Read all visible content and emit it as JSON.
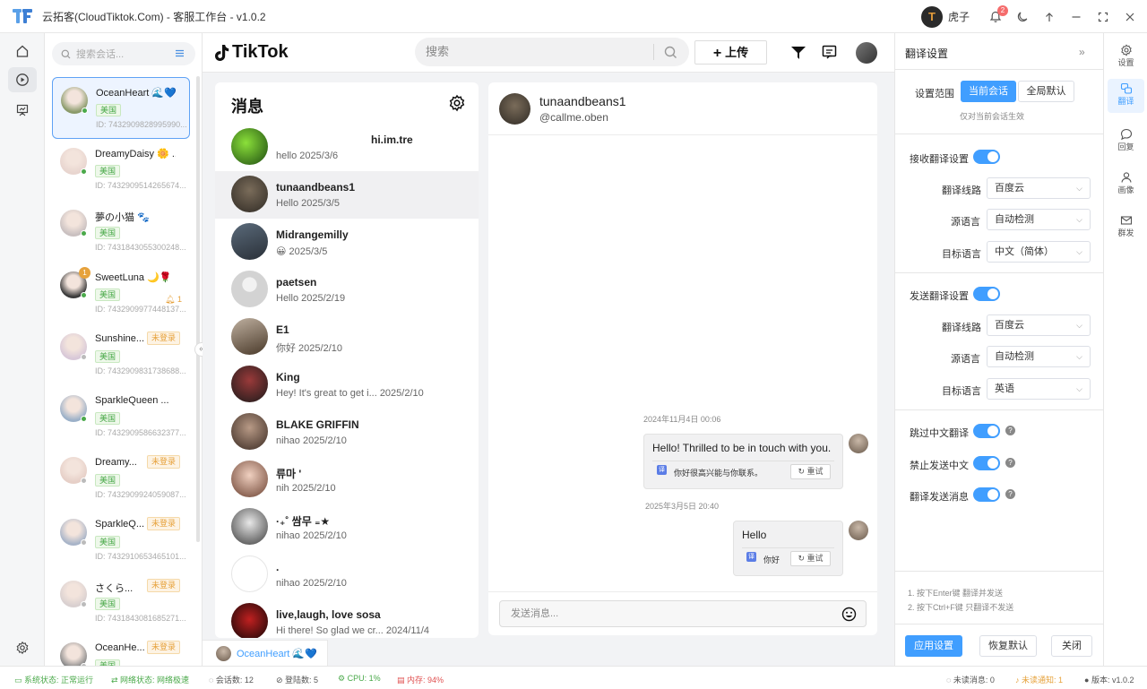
{
  "window": {
    "title": "云拓客(CloudTiktok.Com) - 客服工作台 - v1.0.2",
    "user_name": "虎子",
    "notif_count": "2"
  },
  "accounts": {
    "search_placeholder": "搜索会话...",
    "items": [
      {
        "name": "OceanHeart 🌊💙",
        "region": "美国",
        "id": "ID: 7432909828995990..."
      },
      {
        "name": "DreamyDaisy 🌼 ...",
        "region": "美国",
        "id": "ID: 7432909514265674..."
      },
      {
        "name": "夢の小猫 🐾",
        "region": "美国",
        "id": "ID: 7431843055300248..."
      },
      {
        "name": "SweetLuna 🌙🌹",
        "region": "美国",
        "id": "ID: 7432909977448137...",
        "badge": "1",
        "notif": "1"
      },
      {
        "name": "Sunshine...",
        "region": "美国",
        "id": "ID: 7432909831738688...",
        "status": "未登录"
      },
      {
        "name": "SparkleQueen ...",
        "region": "美国",
        "id": "ID: 7432909586632377..."
      },
      {
        "name": "Dreamy...",
        "region": "美国",
        "id": "ID: 7432909924059087...",
        "status": "未登录"
      },
      {
        "name": "SparkleQ...",
        "region": "美国",
        "id": "ID: 7432910653465101...",
        "status": "未登录"
      },
      {
        "name": "さくら...",
        "region": "美国",
        "id": "ID: 7431843081685271...",
        "status": "未登录"
      },
      {
        "name": "OceanHe...",
        "region": "美国",
        "id": "",
        "status": "未登录"
      }
    ]
  },
  "tiktok": {
    "brand": "TikTok",
    "search_placeholder": "搜索",
    "upload_label": "上传"
  },
  "messages": {
    "title": "消息",
    "conversations": [
      {
        "name": "hi.im.tre",
        "preview": "hello 2025/3/6"
      },
      {
        "name": "tunaandbeans1",
        "preview": "Hello 2025/3/5"
      },
      {
        "name": "Midrangemilly",
        "preview": "😀 2025/3/5"
      },
      {
        "name": "paetsen",
        "preview": "Hello 2025/2/19"
      },
      {
        "name": "E1",
        "preview": "你好 2025/2/10"
      },
      {
        "name": "King",
        "preview": "Hey! It's great to get i...   2025/2/10"
      },
      {
        "name": "BLAKE GRIFFIN",
        "preview": "nihao 2025/2/10"
      },
      {
        "name": "류마 '",
        "preview": "nih 2025/2/10"
      },
      {
        "name": "·₊˚ 쌈무 ₌★",
        "preview": "nihao 2025/2/10"
      },
      {
        "name": ".",
        "preview": "nihao 2025/2/10"
      },
      {
        "name": "live,laugh, love sosa",
        "preview": "Hi there! So glad we cr...   2024/11/4"
      }
    ]
  },
  "chat": {
    "contact_name": "tunaandbeans1",
    "contact_handle": "@callme.oben",
    "messages": [
      {
        "time": "2024年11月4日 00:06",
        "text": "Hello! Thrilled to be in touch with you.",
        "translation": "你好很高兴能与你联系。",
        "retry": "重试"
      },
      {
        "time": "2025年3月5日 20:40",
        "text": "Hello",
        "translation": "你好",
        "retry": "重试"
      }
    ],
    "input_placeholder": "发送消息..."
  },
  "bottom_tab": {
    "label": "OceanHeart 🌊💙"
  },
  "translation": {
    "title": "翻译设置",
    "scope_label": "设置范围",
    "scope_current": "当前会话",
    "scope_global": "全局默认",
    "scope_hint": "仅对当前会话生效",
    "receive": {
      "title": "接收翻译设置",
      "route_label": "翻译线路",
      "route_value": "百度云",
      "src_label": "源语言",
      "src_value": "自动检测",
      "tgt_label": "目标语言",
      "tgt_value": "中文（简体）"
    },
    "send": {
      "title": "发送翻译设置",
      "route_label": "翻译线路",
      "route_value": "百度云",
      "src_label": "源语言",
      "src_value": "自动检测",
      "tgt_label": "目标语言",
      "tgt_value": "英语"
    },
    "skip_chinese": "跳过中文翻译",
    "forbid_chinese": "禁止发送中文",
    "translate_send": "翻译发送消息",
    "tip1": "1. 按下Enter键 翻译并发送",
    "tip2": "2. 按下Ctrl+F键 只翻译不发送",
    "apply": "应用设置",
    "reset": "恢复默认",
    "close": "关闭"
  },
  "right_rail": [
    {
      "label": "设置",
      "icon": "gear-icon"
    },
    {
      "label": "翻译",
      "icon": "translate-icon"
    },
    {
      "label": "回复",
      "icon": "reply-icon"
    },
    {
      "label": "画像",
      "icon": "profile-icon"
    },
    {
      "label": "群发",
      "icon": "mail-icon"
    }
  ],
  "status": {
    "system": "系统状态: 正常运行",
    "network": "网络状态: 网络极速",
    "sessions": "会话数: 12",
    "logins": "登陆数: 5",
    "cpu": "CPU: 1%",
    "memory": "内存: 94%",
    "unread_msgs": "未读消息: 0",
    "unread_notice": "未读通知: 1",
    "version": "版本: v1.0.2"
  },
  "colors": {
    "accent": "#409eff",
    "green": "#4aa94a",
    "warning": "#e6a23c",
    "danger": "#e05050"
  }
}
